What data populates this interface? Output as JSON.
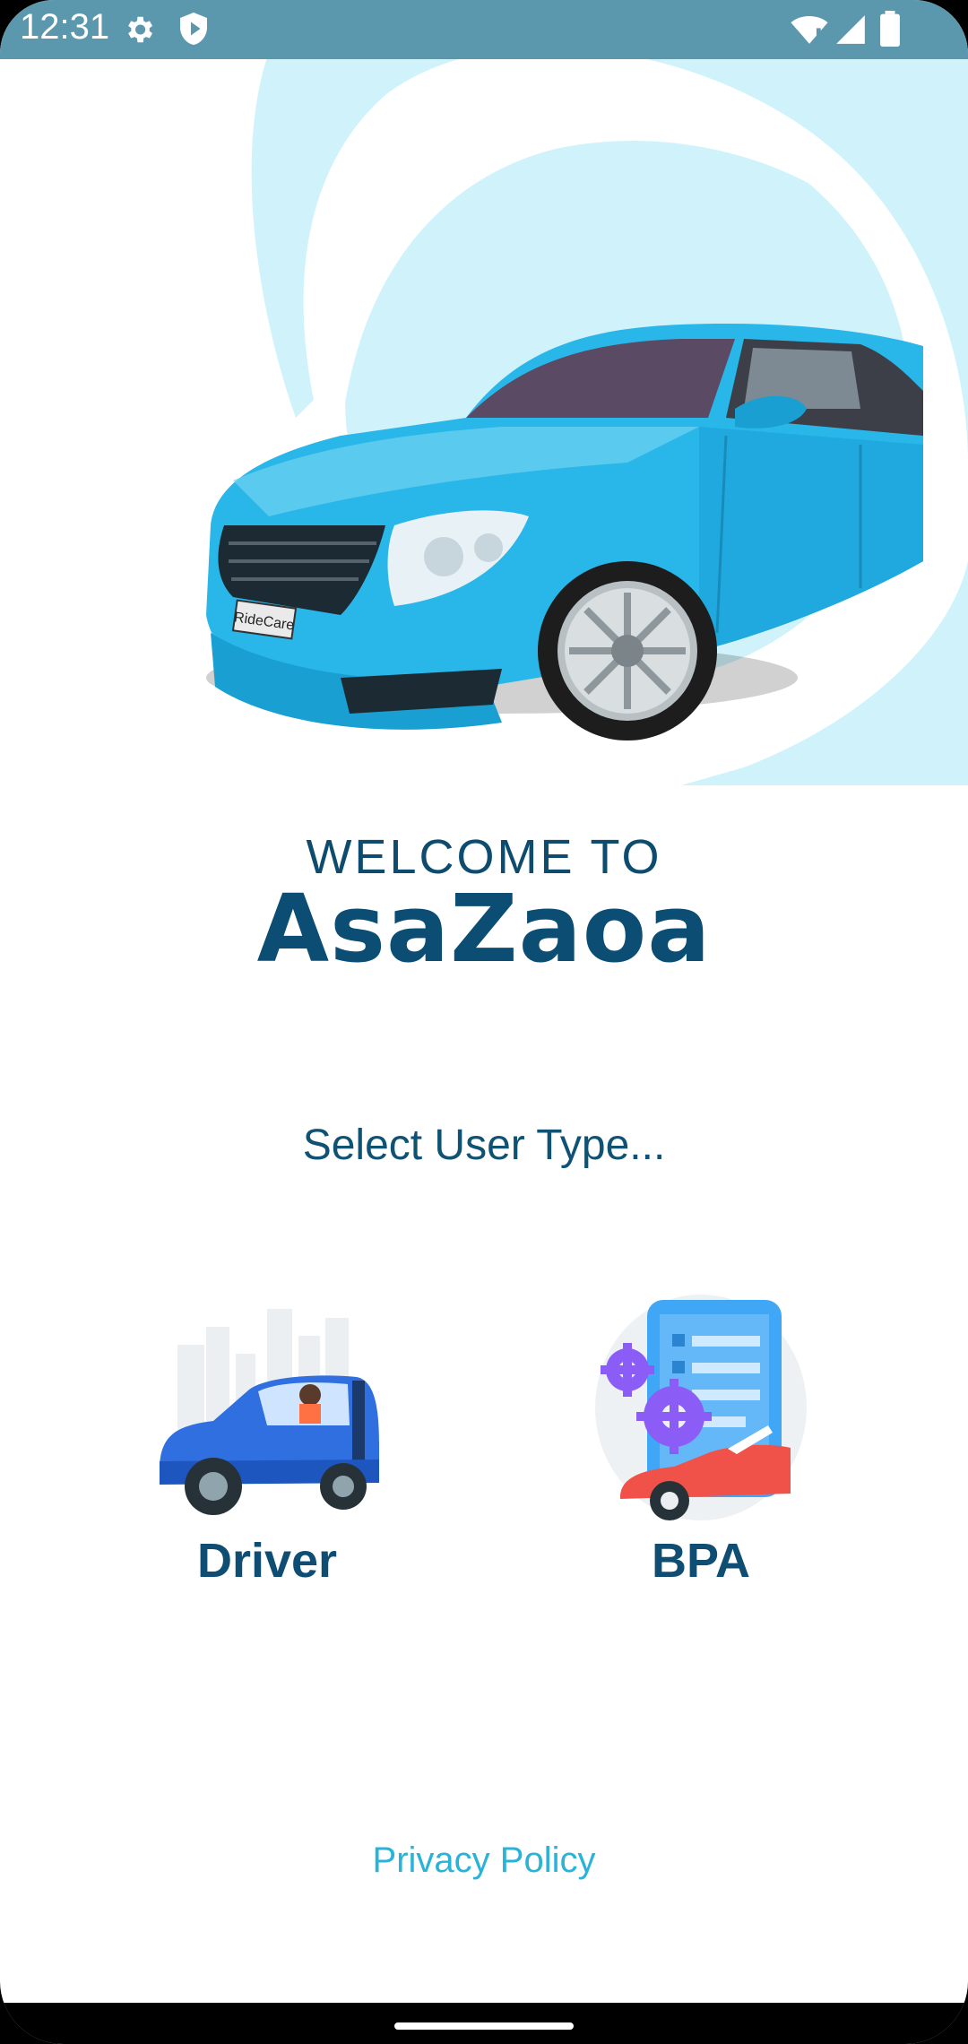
{
  "status_bar": {
    "time": "12:31",
    "icons": [
      "gear-icon",
      "shield-icon",
      "wifi-icon",
      "signal-icon",
      "battery-icon"
    ]
  },
  "hero": {
    "plate_text": "RideCare",
    "colors": {
      "circle": "#d0f3fb",
      "car_body": "#29b6e8"
    }
  },
  "welcome": {
    "line1": "WELCOME TO",
    "brand": "AsaZaoa"
  },
  "select_label": "Select User Type...",
  "user_types": [
    {
      "label": "Driver",
      "icon": "driver-car-icon"
    },
    {
      "label": "BPA",
      "icon": "bpa-gears-icon"
    }
  ],
  "footer": {
    "privacy_label": "Privacy Policy"
  },
  "theme": {
    "primary": "#0b4d73",
    "accent": "#2ab3d8",
    "status_bar": "#5b97ad"
  }
}
